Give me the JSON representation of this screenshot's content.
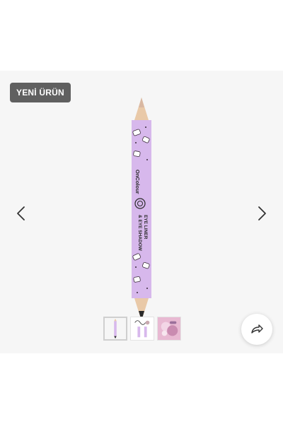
{
  "badge": {
    "label": "YENİ ÜRÜN"
  },
  "product": {
    "brand_label": "OnColour",
    "name_line1": "EYE LINER",
    "name_line2": "& EYE SHADOW"
  },
  "gallery": {
    "thumbnail_count": 3,
    "active_thumbnail": 1
  },
  "icons": {
    "prev": "chevron-left-icon",
    "next": "chevron-right-icon",
    "share": "share-arrow-icon"
  },
  "colors": {
    "gallery_background": "#f6f6f6",
    "badge_background": "#606060",
    "pencil_body": "#d7b8ec",
    "pencil_wood": "#e9c9a8",
    "tip_light": "#d9b8a2",
    "tip_dark": "#2a2a2a"
  }
}
